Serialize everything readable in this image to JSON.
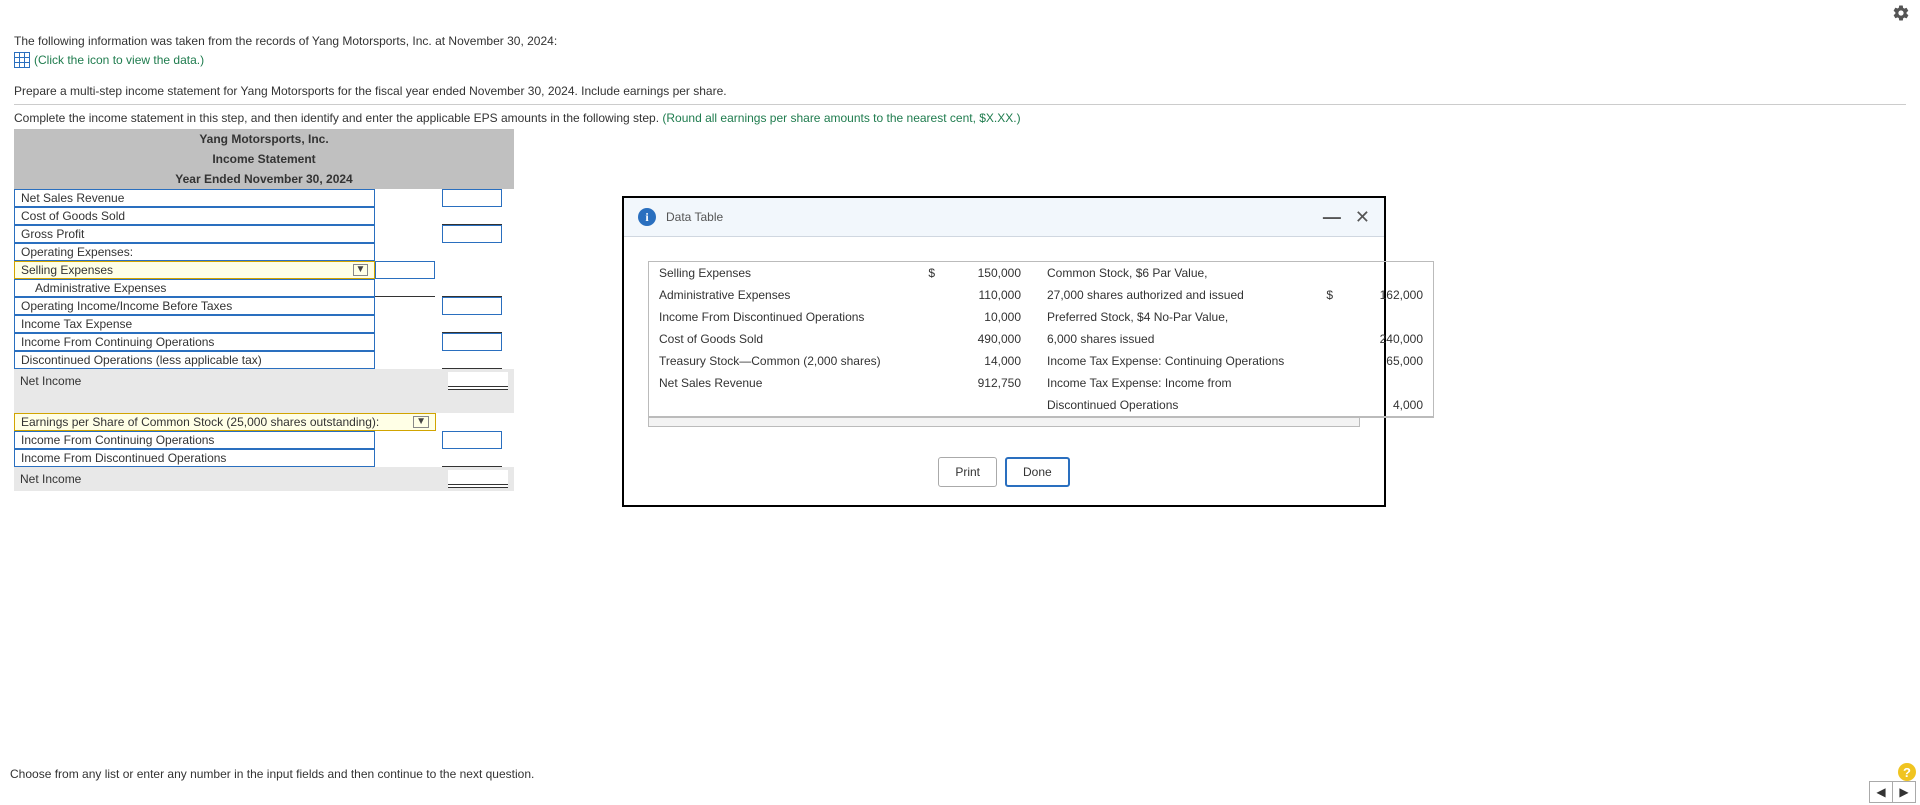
{
  "header": {
    "gear_icon": "settings"
  },
  "intro": {
    "line1": "The following information was taken from the records of Yang Motorsports, Inc. at November 30, 2024:",
    "click_text": "(Click the icon to view the data.)",
    "line2": "Prepare a multi-step income statement for Yang Motorsports for the fiscal year ended November 30, 2024. Include earnings per share.",
    "line3a": "Complete the income statement in this step, and then identify and enter the applicable EPS amounts in the following step. ",
    "line3b": "(Round all earnings per share amounts to the nearest cent, $X.XX.)"
  },
  "statement": {
    "title1": "Yang Motorsports, Inc.",
    "title2": "Income Statement",
    "title3": "Year Ended November 30, 2024",
    "rows": {
      "r0": "Net Sales Revenue",
      "r1": "Cost of Goods Sold",
      "r2": "Gross Profit",
      "r3": "Operating Expenses:",
      "r4": "Selling Expenses",
      "r5": "Administrative Expenses",
      "r6": "Operating Income/Income Before Taxes",
      "r7": "Income Tax Expense",
      "r8": "Income From Continuing Operations",
      "r9": "Discontinued Operations (less applicable tax)",
      "r10": "Net Income",
      "r11": "Earnings per Share of Common Stock (25,000 shares outstanding):",
      "r12": "Income From Continuing Operations",
      "r13": "Income From Discontinued Operations",
      "r14": "Net Income"
    }
  },
  "modal": {
    "title": "Data Table",
    "print": "Print",
    "done": "Done",
    "left": [
      {
        "label": "Selling Expenses",
        "cur": "$",
        "val": "150,000"
      },
      {
        "label": "Administrative Expenses",
        "cur": "",
        "val": "110,000"
      },
      {
        "label": "Income From Discontinued Operations",
        "cur": "",
        "val": "10,000"
      },
      {
        "label": "Cost of Goods Sold",
        "cur": "",
        "val": "490,000"
      },
      {
        "label": "Treasury Stock—Common (2,000 shares)",
        "cur": "",
        "val": "14,000"
      },
      {
        "label": "Net Sales Revenue",
        "cur": "",
        "val": "912,750"
      }
    ],
    "right": [
      {
        "label": "Common Stock, $6 Par Value,",
        "cur": "",
        "val": ""
      },
      {
        "label": "27,000 shares authorized and issued",
        "cur": "$",
        "val": "162,000"
      },
      {
        "label": "Preferred Stock, $4 No-Par Value,",
        "cur": "",
        "val": ""
      },
      {
        "label": "6,000 shares issued",
        "cur": "",
        "val": "240,000"
      },
      {
        "label": "Income Tax Expense: Continuing Operations",
        "cur": "",
        "val": "65,000"
      },
      {
        "label": "Income Tax Expense: Income from",
        "cur": "",
        "val": ""
      },
      {
        "label": "Discontinued Operations",
        "cur": "",
        "val": "4,000"
      }
    ]
  },
  "footer": {
    "hint": "Choose from any list or enter any number in the input fields and then continue to the next question."
  }
}
